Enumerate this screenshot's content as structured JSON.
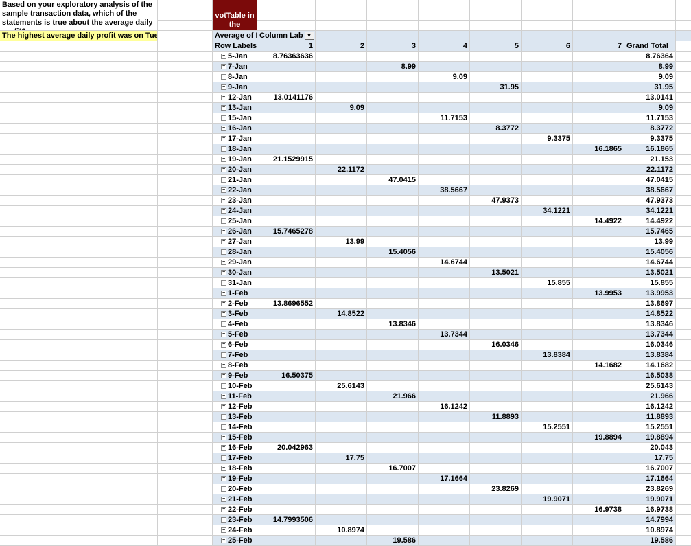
{
  "question": "Based on your exploratory analysis of the sample transaction data, which of the statements is true about the average daily profit?",
  "answer": "The highest average daily profit was on Tuesday.",
  "darkred_label": "votTable in the",
  "pivot": {
    "values_label": "Average of Pr",
    "cols_label": "Column Lab",
    "rows_label": "Row Labels",
    "grand_total_label": "Grand Total",
    "col_numbers": [
      "1",
      "2",
      "3",
      "4",
      "5",
      "6",
      "7"
    ]
  },
  "rows": [
    {
      "label": "5-Jan",
      "v": [
        "8.76363636",
        "",
        "",
        "",
        "",
        "",
        ""
      ],
      "gt": "8.76364"
    },
    {
      "label": "7-Jan",
      "v": [
        "",
        "",
        "8.99",
        "",
        "",
        "",
        ""
      ],
      "gt": "8.99"
    },
    {
      "label": "8-Jan",
      "v": [
        "",
        "",
        "",
        "9.09",
        "",
        "",
        ""
      ],
      "gt": "9.09"
    },
    {
      "label": "9-Jan",
      "v": [
        "",
        "",
        "",
        "",
        "31.95",
        "",
        ""
      ],
      "gt": "31.95"
    },
    {
      "label": "12-Jan",
      "v": [
        "13.0141176",
        "",
        "",
        "",
        "",
        "",
        ""
      ],
      "gt": "13.0141"
    },
    {
      "label": "13-Jan",
      "v": [
        "",
        "9.09",
        "",
        "",
        "",
        "",
        ""
      ],
      "gt": "9.09"
    },
    {
      "label": "15-Jan",
      "v": [
        "",
        "",
        "",
        "11.7153",
        "",
        "",
        ""
      ],
      "gt": "11.7153"
    },
    {
      "label": "16-Jan",
      "v": [
        "",
        "",
        "",
        "",
        "8.3772",
        "",
        ""
      ],
      "gt": "8.3772"
    },
    {
      "label": "17-Jan",
      "v": [
        "",
        "",
        "",
        "",
        "",
        "9.3375",
        ""
      ],
      "gt": "9.3375"
    },
    {
      "label": "18-Jan",
      "v": [
        "",
        "",
        "",
        "",
        "",
        "",
        "16.1865"
      ],
      "gt": "16.1865"
    },
    {
      "label": "19-Jan",
      "v": [
        "21.1529915",
        "",
        "",
        "",
        "",
        "",
        ""
      ],
      "gt": "21.153"
    },
    {
      "label": "20-Jan",
      "v": [
        "",
        "22.1172",
        "",
        "",
        "",
        "",
        ""
      ],
      "gt": "22.1172"
    },
    {
      "label": "21-Jan",
      "v": [
        "",
        "",
        "47.0415",
        "",
        "",
        "",
        ""
      ],
      "gt": "47.0415"
    },
    {
      "label": "22-Jan",
      "v": [
        "",
        "",
        "",
        "38.5667",
        "",
        "",
        ""
      ],
      "gt": "38.5667"
    },
    {
      "label": "23-Jan",
      "v": [
        "",
        "",
        "",
        "",
        "47.9373",
        "",
        ""
      ],
      "gt": "47.9373"
    },
    {
      "label": "24-Jan",
      "v": [
        "",
        "",
        "",
        "",
        "",
        "34.1221",
        ""
      ],
      "gt": "34.1221"
    },
    {
      "label": "25-Jan",
      "v": [
        "",
        "",
        "",
        "",
        "",
        "",
        "14.4922"
      ],
      "gt": "14.4922"
    },
    {
      "label": "26-Jan",
      "v": [
        "15.7465278",
        "",
        "",
        "",
        "",
        "",
        ""
      ],
      "gt": "15.7465"
    },
    {
      "label": "27-Jan",
      "v": [
        "",
        "13.99",
        "",
        "",
        "",
        "",
        ""
      ],
      "gt": "13.99"
    },
    {
      "label": "28-Jan",
      "v": [
        "",
        "",
        "15.4056",
        "",
        "",
        "",
        ""
      ],
      "gt": "15.4056"
    },
    {
      "label": "29-Jan",
      "v": [
        "",
        "",
        "",
        "14.6744",
        "",
        "",
        ""
      ],
      "gt": "14.6744"
    },
    {
      "label": "30-Jan",
      "v": [
        "",
        "",
        "",
        "",
        "13.5021",
        "",
        ""
      ],
      "gt": "13.5021"
    },
    {
      "label": "31-Jan",
      "v": [
        "",
        "",
        "",
        "",
        "",
        "15.855",
        ""
      ],
      "gt": "15.855"
    },
    {
      "label": "1-Feb",
      "v": [
        "",
        "",
        "",
        "",
        "",
        "",
        "13.9953"
      ],
      "gt": "13.9953"
    },
    {
      "label": "2-Feb",
      "v": [
        "13.8696552",
        "",
        "",
        "",
        "",
        "",
        ""
      ],
      "gt": "13.8697"
    },
    {
      "label": "3-Feb",
      "v": [
        "",
        "14.8522",
        "",
        "",
        "",
        "",
        ""
      ],
      "gt": "14.8522"
    },
    {
      "label": "4-Feb",
      "v": [
        "",
        "",
        "13.8346",
        "",
        "",
        "",
        ""
      ],
      "gt": "13.8346"
    },
    {
      "label": "5-Feb",
      "v": [
        "",
        "",
        "",
        "13.7344",
        "",
        "",
        ""
      ],
      "gt": "13.7344"
    },
    {
      "label": "6-Feb",
      "v": [
        "",
        "",
        "",
        "",
        "16.0346",
        "",
        ""
      ],
      "gt": "16.0346"
    },
    {
      "label": "7-Feb",
      "v": [
        "",
        "",
        "",
        "",
        "",
        "13.8384",
        ""
      ],
      "gt": "13.8384"
    },
    {
      "label": "8-Feb",
      "v": [
        "",
        "",
        "",
        "",
        "",
        "",
        "14.1682"
      ],
      "gt": "14.1682"
    },
    {
      "label": "9-Feb",
      "v": [
        "16.50375",
        "",
        "",
        "",
        "",
        "",
        ""
      ],
      "gt": "16.5038"
    },
    {
      "label": "10-Feb",
      "v": [
        "",
        "25.6143",
        "",
        "",
        "",
        "",
        ""
      ],
      "gt": "25.6143"
    },
    {
      "label": "11-Feb",
      "v": [
        "",
        "",
        "21.966",
        "",
        "",
        "",
        ""
      ],
      "gt": "21.966"
    },
    {
      "label": "12-Feb",
      "v": [
        "",
        "",
        "",
        "16.1242",
        "",
        "",
        ""
      ],
      "gt": "16.1242"
    },
    {
      "label": "13-Feb",
      "v": [
        "",
        "",
        "",
        "",
        "11.8893",
        "",
        ""
      ],
      "gt": "11.8893"
    },
    {
      "label": "14-Feb",
      "v": [
        "",
        "",
        "",
        "",
        "",
        "15.2551",
        ""
      ],
      "gt": "15.2551"
    },
    {
      "label": "15-Feb",
      "v": [
        "",
        "",
        "",
        "",
        "",
        "",
        "19.8894"
      ],
      "gt": "19.8894"
    },
    {
      "label": "16-Feb",
      "v": [
        "20.042963",
        "",
        "",
        "",
        "",
        "",
        ""
      ],
      "gt": "20.043"
    },
    {
      "label": "17-Feb",
      "v": [
        "",
        "17.75",
        "",
        "",
        "",
        "",
        ""
      ],
      "gt": "17.75"
    },
    {
      "label": "18-Feb",
      "v": [
        "",
        "",
        "16.7007",
        "",
        "",
        "",
        ""
      ],
      "gt": "16.7007"
    },
    {
      "label": "19-Feb",
      "v": [
        "",
        "",
        "",
        "17.1664",
        "",
        "",
        ""
      ],
      "gt": "17.1664"
    },
    {
      "label": "20-Feb",
      "v": [
        "",
        "",
        "",
        "",
        "23.8269",
        "",
        ""
      ],
      "gt": "23.8269"
    },
    {
      "label": "21-Feb",
      "v": [
        "",
        "",
        "",
        "",
        "",
        "19.9071",
        ""
      ],
      "gt": "19.9071"
    },
    {
      "label": "22-Feb",
      "v": [
        "",
        "",
        "",
        "",
        "",
        "",
        "16.9738"
      ],
      "gt": "16.9738"
    },
    {
      "label": "23-Feb",
      "v": [
        "14.7993506",
        "",
        "",
        "",
        "",
        "",
        ""
      ],
      "gt": "14.7994"
    },
    {
      "label": "24-Feb",
      "v": [
        "",
        "10.8974",
        "",
        "",
        "",
        "",
        ""
      ],
      "gt": "10.8974"
    },
    {
      "label": "25-Feb",
      "v": [
        "",
        "",
        "19.586",
        "",
        "",
        "",
        ""
      ],
      "gt": "19.586"
    }
  ]
}
